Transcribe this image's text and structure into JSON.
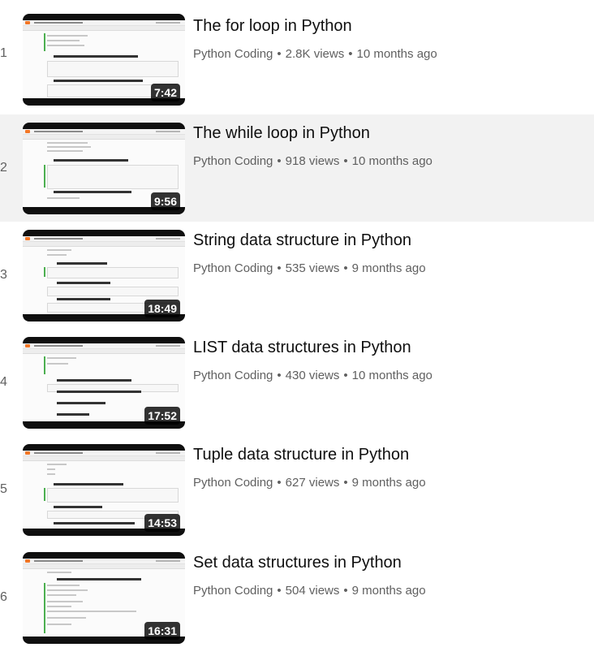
{
  "videos": [
    {
      "index": "1",
      "title": "The for loop in Python",
      "channel": "Python Coding",
      "views": "2.8K views",
      "age": "10 months ago",
      "duration": "7:42"
    },
    {
      "index": "2",
      "title": "The while loop in Python",
      "channel": "Python Coding",
      "views": "918 views",
      "age": "10 months ago",
      "duration": "9:56"
    },
    {
      "index": "3",
      "title": "String data structure in Python",
      "channel": "Python Coding",
      "views": "535 views",
      "age": "9 months ago",
      "duration": "18:49"
    },
    {
      "index": "4",
      "title": "LIST data structures in Python",
      "channel": "Python Coding",
      "views": "430 views",
      "age": "10 months ago",
      "duration": "17:52"
    },
    {
      "index": "5",
      "title": "Tuple data structure in Python",
      "channel": "Python Coding",
      "views": "627 views",
      "age": "9 months ago",
      "duration": "14:53"
    },
    {
      "index": "6",
      "title": "Set data structures in Python",
      "channel": "Python Coding",
      "views": "504 views",
      "age": "9 months ago",
      "duration": "16:31"
    }
  ],
  "separator": "•",
  "colors": {
    "active_row_bg": "#f2f2f2",
    "meta_text": "#606060",
    "duration_bg": "#000000cc",
    "jupyter_orange": "#f37726"
  }
}
